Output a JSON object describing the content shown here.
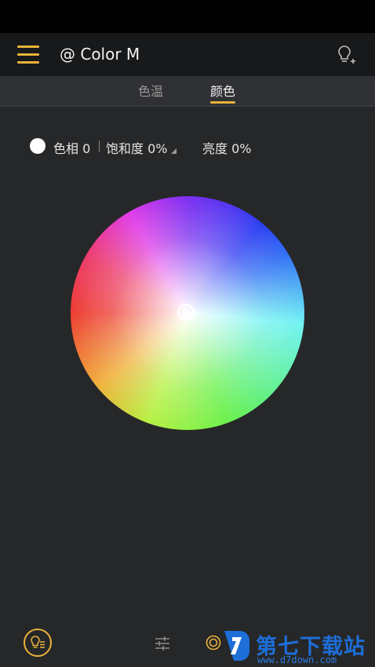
{
  "app": {
    "title": "@ Color M",
    "menu_icon": "hamburger-menu-icon",
    "add_icon": "add-bulb-icon"
  },
  "tabs": [
    {
      "label": "色温",
      "active": false
    },
    {
      "label": "颜色",
      "active": true
    }
  ],
  "color_info": {
    "swatch_color": "#ffffff",
    "hue": "色相 0",
    "saturation": "饱和度 0%",
    "brightness": "亮度 0%"
  },
  "bottom_nav": {
    "items": [
      {
        "icon": "bulb-list-icon"
      },
      {
        "icon": "sliders-icon"
      },
      {
        "icon": "target-ring-icon"
      }
    ]
  },
  "watermark": {
    "text": "第七下载站",
    "url": "www.d7down.com"
  },
  "colors": {
    "accent": "#e9b23a",
    "background": "#262729",
    "appbar": "#18191b",
    "watermark_blue": "#1d6ed8"
  }
}
